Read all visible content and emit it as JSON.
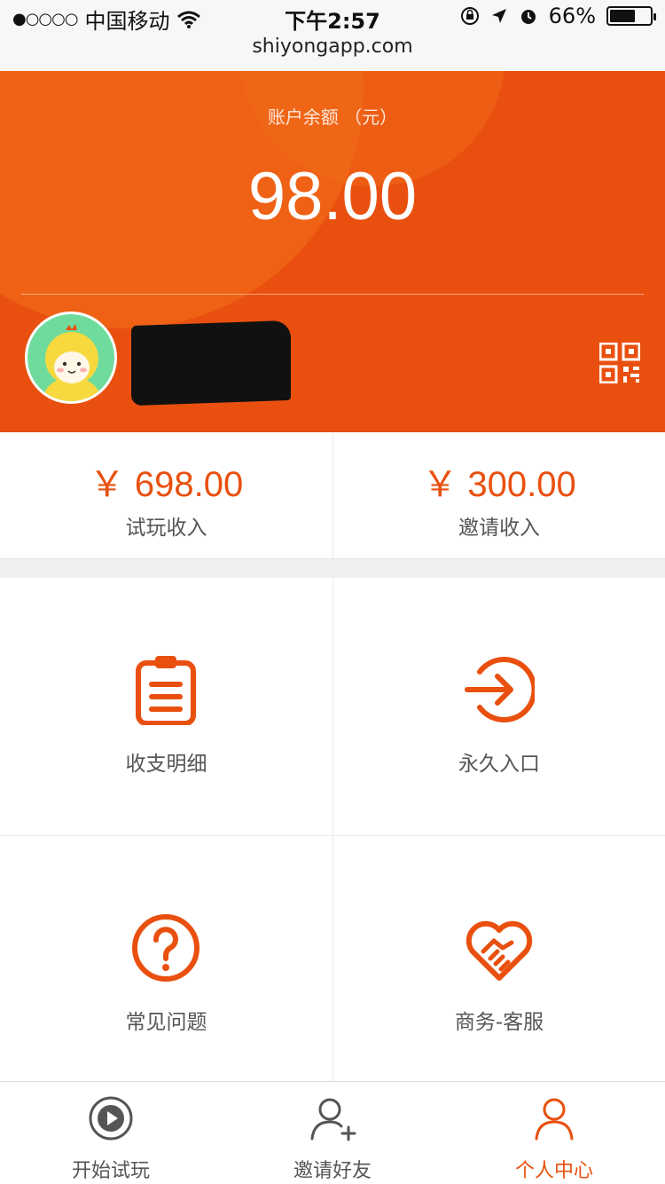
{
  "status_bar": {
    "carrier": "中国移动",
    "time": "下午2:57",
    "battery": "66%",
    "battery_level": 0.66,
    "url": "shiyongapp.com"
  },
  "header": {
    "balance_label": "账户余额 （元）",
    "balance": "98.00"
  },
  "income": [
    {
      "value": "￥ 698.00",
      "label": "试玩收入"
    },
    {
      "value": "￥ 300.00",
      "label": "邀请收入"
    }
  ],
  "menu": [
    {
      "label": "收支明细",
      "icon": "clipboard-list-icon"
    },
    {
      "label": "永久入口",
      "icon": "arrow-in-circle-icon"
    },
    {
      "label": "常见问题",
      "icon": "question-circle-icon"
    },
    {
      "label": "商务-客服",
      "icon": "heart-handshake-icon"
    }
  ],
  "tabs": [
    {
      "label": "开始试玩",
      "icon": "play-circle-icon"
    },
    {
      "label": "邀请好友",
      "icon": "add-user-icon"
    },
    {
      "label": "个人中心",
      "icon": "user-icon",
      "active": true
    }
  ],
  "colors": {
    "accent": "#e9500f",
    "header_bg": "#e9500f"
  }
}
